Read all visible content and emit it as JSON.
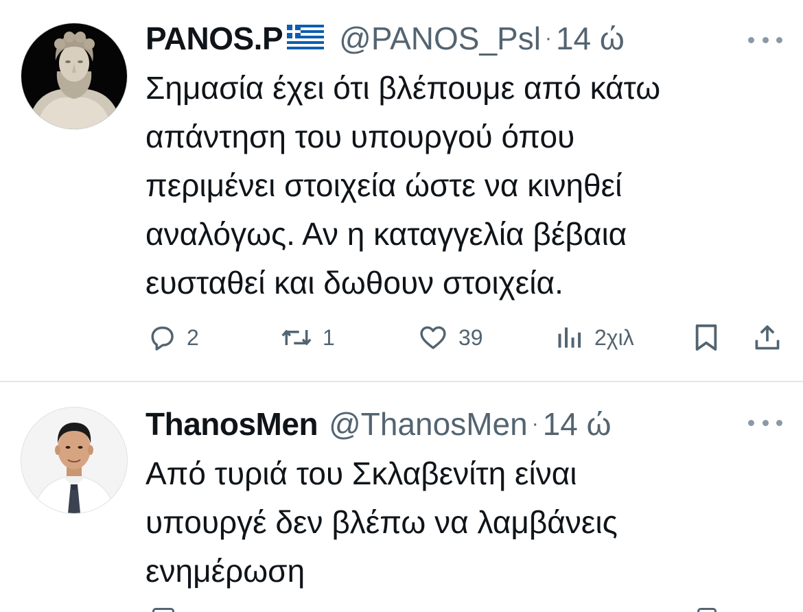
{
  "tweets": [
    {
      "display_name": "PANOS.P",
      "flag_icon": "greek-flag-icon",
      "handle": "@PANOS_Psl",
      "separator": "·",
      "time": "14 ώ",
      "avatar_icon": "statue-avatar",
      "text_lines": [
        "Σημασία έχει ότι βλέπουμε από κάτω",
        "απάντηση του υπουργού όπου",
        "περιμένει στοιχεία ώστε να κινηθεί",
        "αναλόγως. Αν η καταγγελία βέβαια",
        "ευσταθεί και δωθουν στοιχεία."
      ],
      "actions": {
        "replies": "2",
        "retweets": "1",
        "likes": "39",
        "views": "2χιλ"
      }
    },
    {
      "display_name": "ThanosMen",
      "handle": "@ThanosMen",
      "separator": "·",
      "time": "14 ώ",
      "avatar_icon": "man-portrait-avatar",
      "text_lines": [
        "Από τυριά του Σκλαβενίτη είναι",
        "υπουργέ δεν βλέπω να λαμβάνεις",
        "ενημέρωση"
      ]
    }
  ],
  "colors": {
    "text_primary": "#0f1419",
    "text_secondary": "#536471",
    "divider": "#e1e6ea",
    "flag_blue": "#0d5eaf"
  },
  "icons": {
    "reply": "reply-icon",
    "retweet": "retweet-icon",
    "like": "heart-icon",
    "views": "views-chart-icon",
    "bookmark": "bookmark-icon",
    "share": "share-icon",
    "more": "more-dots-icon"
  }
}
